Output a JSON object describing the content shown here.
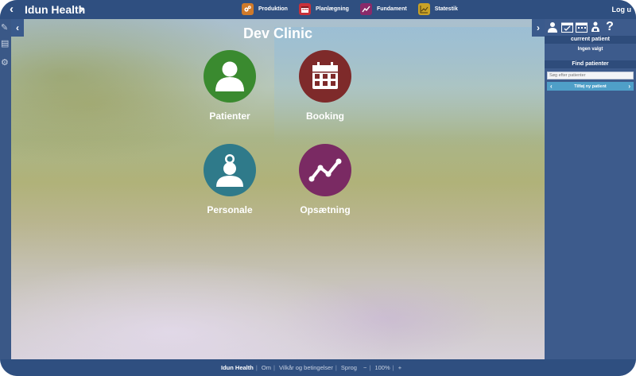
{
  "topbar": {
    "back": "‹",
    "brand": "Idun Health",
    "brand_arrow": "›",
    "logout": "Log u",
    "modules": [
      {
        "label": "Produktion",
        "icon": "gears-icon",
        "color": "#d07a2a"
      },
      {
        "label": "Planlægning",
        "icon": "calendar-icon",
        "color": "#c8313a"
      },
      {
        "label": "Fundament",
        "icon": "trend-icon",
        "color": "#8a2a6a"
      },
      {
        "label": "Statestik",
        "icon": "chart-icon",
        "color": "#c9a227"
      }
    ]
  },
  "main": {
    "clinic_name": "Dev Clinic",
    "tiles": [
      {
        "label": "Patienter",
        "icon": "person-icon",
        "color": "#3a8a2f"
      },
      {
        "label": "Booking",
        "icon": "calendar-icon",
        "color": "#7e2a2a"
      },
      {
        "label": "Personale",
        "icon": "staff-icon",
        "color": "#2f7a8a"
      },
      {
        "label": "Opsætning",
        "icon": "trend-icon",
        "color": "#7a2a63"
      }
    ]
  },
  "right_panel": {
    "current_patient_title": "current patient",
    "current_patient_value": "Ingen valgt",
    "find_title": "Find patienter",
    "search_placeholder": "Søg efter patienter",
    "new_patient": "Tilføj ny patient"
  },
  "footer": {
    "brand": "Idun Health",
    "about": "Om",
    "terms": "Vilkår og betingelser",
    "language": "Sprog",
    "minus": "−",
    "zoom": "100%",
    "plus": "+"
  }
}
